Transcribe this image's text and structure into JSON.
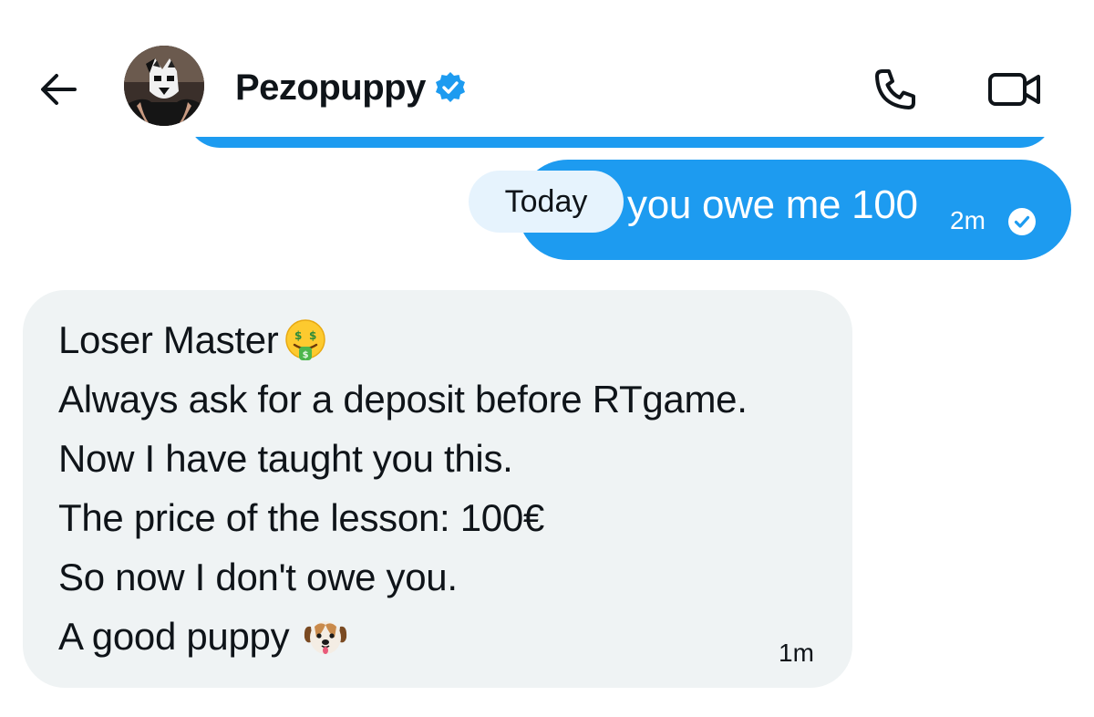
{
  "header": {
    "contact_name": "Pezopuppy",
    "verified": true,
    "icons": {
      "back": "arrow-left-icon",
      "verified": "verified-badge-icon",
      "call": "phone-icon",
      "video": "video-camera-icon"
    }
  },
  "colors": {
    "accent": "#1d9bf0",
    "incoming_bubble": "#eff3f4",
    "today_pill": "#e6f3fd",
    "text": "#0f1419"
  },
  "conversation": {
    "date_separator": "Today",
    "outgoing": {
      "text": "you owe me 100",
      "time": "2m",
      "status_icon": "sent-check-icon"
    },
    "incoming": {
      "lines": [
        "Loser Master",
        "Always ask for a deposit before RTgame.",
        "Now I have taught you this.",
        "The price of the lesson: 100€",
        "So now I don't owe you.",
        "A good puppy"
      ],
      "emojis": {
        "line_1": "money-mouth-face-emoji",
        "line_6": "dog-face-emoji"
      },
      "time": "1m"
    }
  }
}
